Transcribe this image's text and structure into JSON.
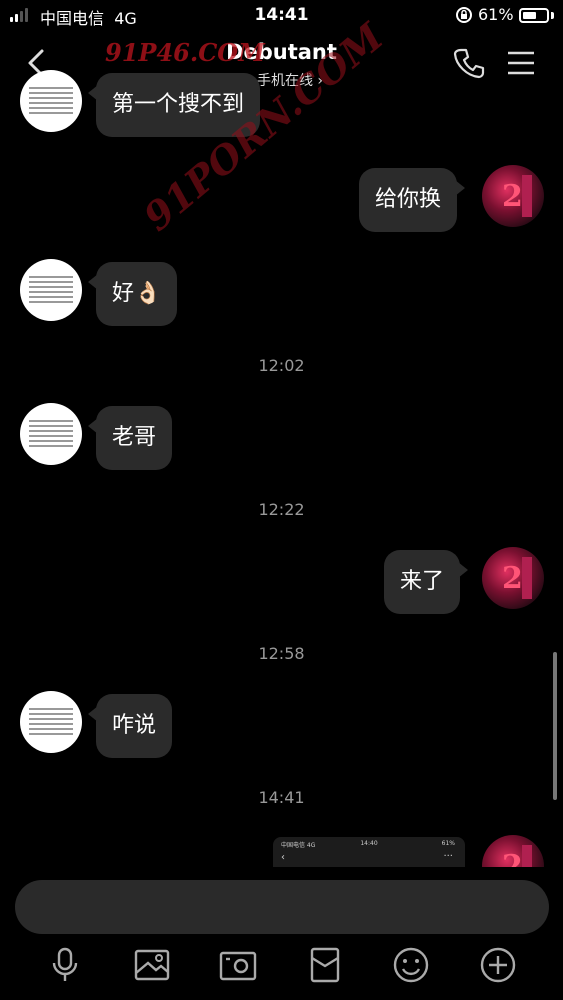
{
  "status_bar": {
    "carrier": "中国电信",
    "network": "4G",
    "time": "14:41",
    "battery": "61%",
    "battery_level": 0.61
  },
  "header": {
    "title": "Debutant",
    "status": "手机在线",
    "status_arrow": "›",
    "watermark": "91P46.COM"
  },
  "watermark_diagonal": "91PORN.COM",
  "messages": [
    {
      "side": "left",
      "text": "第一个搜不到"
    },
    {
      "side": "right",
      "text": "给你换"
    },
    {
      "side": "left",
      "text": "好👌🏻"
    },
    {
      "time": "12:02"
    },
    {
      "side": "left",
      "text": "老哥"
    },
    {
      "time": "12:22"
    },
    {
      "side": "right",
      "text": "来了"
    },
    {
      "time": "12:58"
    },
    {
      "side": "left",
      "text": "咋说"
    },
    {
      "time": "14:41"
    }
  ],
  "screenshot_preview": {
    "carrier": "中国电信  4G",
    "time": "14:40",
    "battery": "61%",
    "back": "‹",
    "more": "···"
  },
  "contact_avatar_text": "2",
  "toolbar": [
    "microphone-icon",
    "image-icon",
    "camera-icon",
    "red-packet-icon",
    "emoji-icon",
    "plus-icon"
  ],
  "colors": {
    "background": "#000000",
    "bubble": "#2b2b2b",
    "online": "#2ecc55",
    "watermark": "#be141e"
  }
}
